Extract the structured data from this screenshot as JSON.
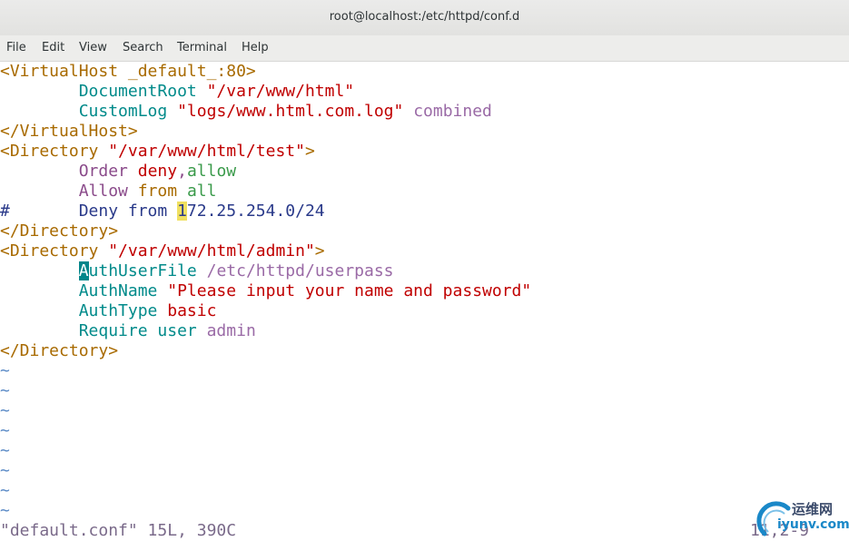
{
  "window": {
    "title": "root@localhost:/etc/httpd/conf.d"
  },
  "menu": [
    "File",
    "Edit",
    "View",
    "Search",
    "Terminal",
    "Help"
  ],
  "file": {
    "l1": {
      "a": "<VirtualHost _default_:80>"
    },
    "l2": {
      "kw": "DocumentRoot",
      "str": "\"/var/www/html\""
    },
    "l3": {
      "kw": "CustomLog",
      "str": "\"logs/www.html.com.log\"",
      "extra": "combined"
    },
    "l4": {
      "a": "</VirtualHost>"
    },
    "l5": {
      "a": "<Directory ",
      "str": "\"/var/www/html/test\"",
      "b": ">"
    },
    "l6": {
      "kw": "Order",
      "v1": "deny",
      "sep": ",",
      "v2": "allow"
    },
    "l7": {
      "kw": "Allow",
      "v1": "from",
      "v2": "all"
    },
    "l8": {
      "hash": "#",
      "kw": "Deny from ",
      "hl": "1",
      "rest": "72.25.254.0/24"
    },
    "l9": {
      "a": "</Directory>"
    },
    "l10": {
      "a": "<Directory ",
      "str": "\"/var/www/html/admin\"",
      "b": ">"
    },
    "l11": {
      "cursor": "A",
      "kw": "uthUserFile",
      "val": "/etc/httpd/userpass"
    },
    "l12": {
      "kw": "AuthName",
      "str": "\"Please input your name and password\""
    },
    "l13": {
      "kw": "AuthType",
      "val": "basic"
    },
    "l14": {
      "kw": "Require user",
      "val": "admin"
    },
    "l15": {
      "a": "</Directory>"
    },
    "tilde": "~"
  },
  "status": {
    "file": "\"default.conf\" 15L, 390C",
    "position": "11,2-9"
  },
  "watermark": {
    "cn": "运维网",
    "en": "iyunv.com"
  }
}
